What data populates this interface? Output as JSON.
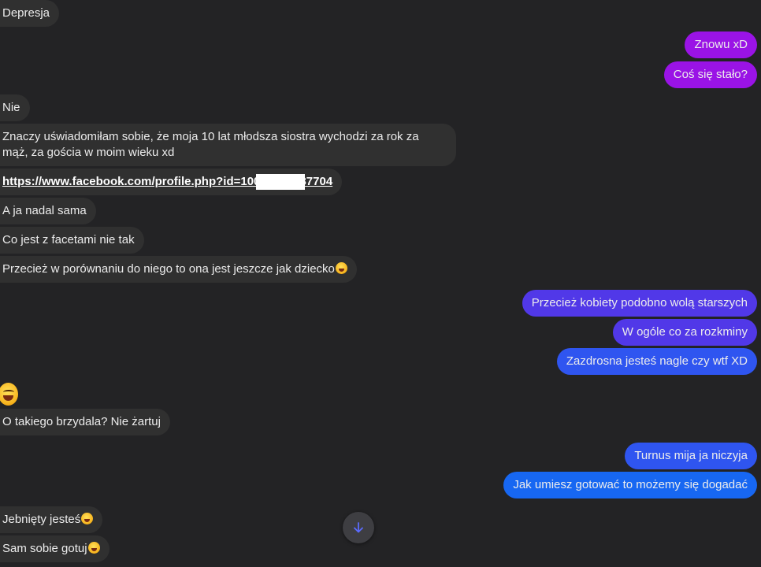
{
  "incoming": [
    {
      "id": "depresja",
      "text": "Depresja"
    },
    {
      "id": "nie",
      "text": "Nie"
    },
    {
      "id": "znaczy",
      "text": "Znaczy uświadomiłam sobie, że moja 10 lat młodsza siostra wychodzi za rok za mąż, za gościa w moim wieku xd"
    },
    {
      "id": "link",
      "text": "https://www.facebook.com/profile.php?id=10000000437704"
    },
    {
      "id": "nadal",
      "text": "A ja nadal sama"
    },
    {
      "id": "facetami",
      "text": "Co jest z facetami nie tak"
    },
    {
      "id": "porownaniu",
      "text": "Przecież w porównaniu do niego to ona jest jeszcze jak dziecko"
    },
    {
      "id": "brzydala",
      "text": "O takiego brzydala? Nie żartuj"
    },
    {
      "id": "jebniety",
      "text": "Jebnięty jesteś"
    },
    {
      "id": "gotuj",
      "text": "Sam sobie gotuj"
    }
  ],
  "outgoing": [
    {
      "id": "znowu",
      "text": "Znowu xD"
    },
    {
      "id": "cos",
      "text": "Coś się stało?"
    },
    {
      "id": "kobiety",
      "text": "Przecież kobiety podobno wolą starszych"
    },
    {
      "id": "ogole",
      "text": "W ogóle co za rozkminy"
    },
    {
      "id": "zazdrosna",
      "text": "Zazdrosna jesteś nagle czy wtf XD"
    },
    {
      "id": "turnus",
      "text": "Turnus mija ja niczyja"
    },
    {
      "id": "gotowac",
      "text": "Jak umiesz gotować to możemy się dogadać"
    }
  ],
  "icons": {
    "emoji": "rolling-on-floor-laughing-icon",
    "scroll": "arrow-down-icon"
  },
  "colors": {
    "background": "#232325",
    "incoming_bubble": "#303030",
    "outgoing_purple": "#9a13e6",
    "outgoing_blue": "#2f55f0"
  }
}
